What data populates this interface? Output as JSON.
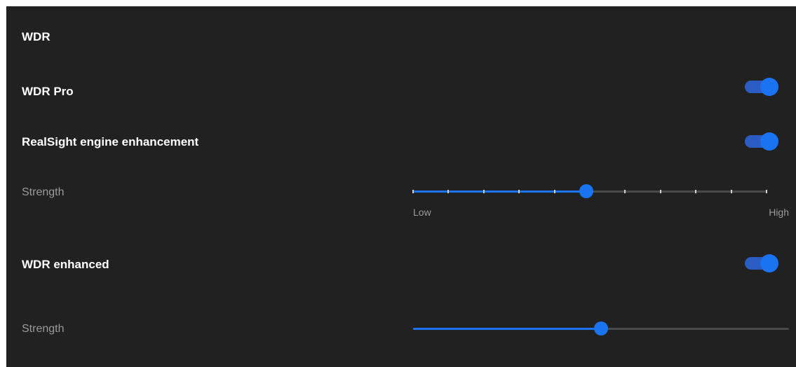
{
  "section": {
    "title": "WDR"
  },
  "wdr_pro": {
    "label": "WDR Pro",
    "enabled": true
  },
  "realsight": {
    "label": "RealSight engine enhancement",
    "enabled": true,
    "strength": {
      "label": "Strength",
      "value": 0.49,
      "steps": 10,
      "low_label": "Low",
      "high_label": "High"
    }
  },
  "wdr_enhanced": {
    "label": "WDR enhanced",
    "enabled": true,
    "strength": {
      "label": "Strength",
      "value": 0.5
    }
  },
  "colors": {
    "background": "#212121",
    "accent": "#1a73f0",
    "accent_track": "#2a5cc4",
    "label": "#ffffff",
    "secondary_label": "#9a9a9a"
  }
}
